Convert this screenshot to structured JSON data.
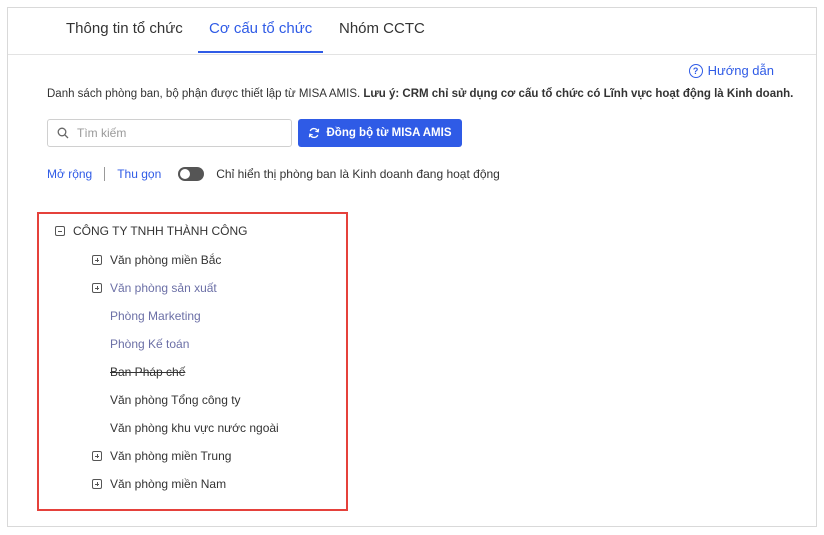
{
  "tabs": [
    {
      "label": "Thông tin tổ chức",
      "active": false
    },
    {
      "label": "Cơ cấu tổ chức",
      "active": true
    },
    {
      "label": "Nhóm CCTC",
      "active": false
    }
  ],
  "guide": {
    "label": "Hướng dẫn",
    "icon": "question-circle-icon"
  },
  "description": {
    "text": "Danh sách phòng ban, bộ phận được thiết lập từ MISA AMIS. ",
    "note": "Lưu ý: CRM chỉ sử dụng cơ cấu tổ chức có Lĩnh vực hoạt động là Kinh doanh."
  },
  "search": {
    "placeholder": "Tìm kiếm",
    "value": ""
  },
  "sync_button": {
    "label": "Đồng bộ từ MISA AMIS",
    "icon": "refresh-icon"
  },
  "controls": {
    "expand": "Mở rộng",
    "collapse": "Thu gọn",
    "toggle_label": "Chỉ hiển thị phòng ban là Kinh doanh đang hoạt động",
    "toggle_on": false
  },
  "tree": {
    "root": "CÔNG TY TNHH THÀNH CÔNG",
    "items": [
      {
        "label": "Văn phòng miền Bắc",
        "expandable": true,
        "style": "normal"
      },
      {
        "label": "Văn phòng sản xuất",
        "expandable": true,
        "style": "muted"
      },
      {
        "label": "Phòng Marketing",
        "expandable": false,
        "style": "muted"
      },
      {
        "label": "Phòng Kế toán",
        "expandable": false,
        "style": "muted"
      },
      {
        "label": "Ban Pháp chế",
        "expandable": false,
        "style": "strike"
      },
      {
        "label": "Văn phòng Tổng công ty",
        "expandable": false,
        "style": "normal"
      },
      {
        "label": "Văn phòng khu vực nước ngoài",
        "expandable": false,
        "style": "normal"
      },
      {
        "label": "Văn phòng miền Trung",
        "expandable": true,
        "style": "normal"
      },
      {
        "label": "Văn phòng miền Nam",
        "expandable": true,
        "style": "normal"
      }
    ]
  },
  "colors": {
    "accent": "#2f5be6",
    "highlight_border": "#e5413b",
    "muted_text": "#6b6fa6"
  }
}
